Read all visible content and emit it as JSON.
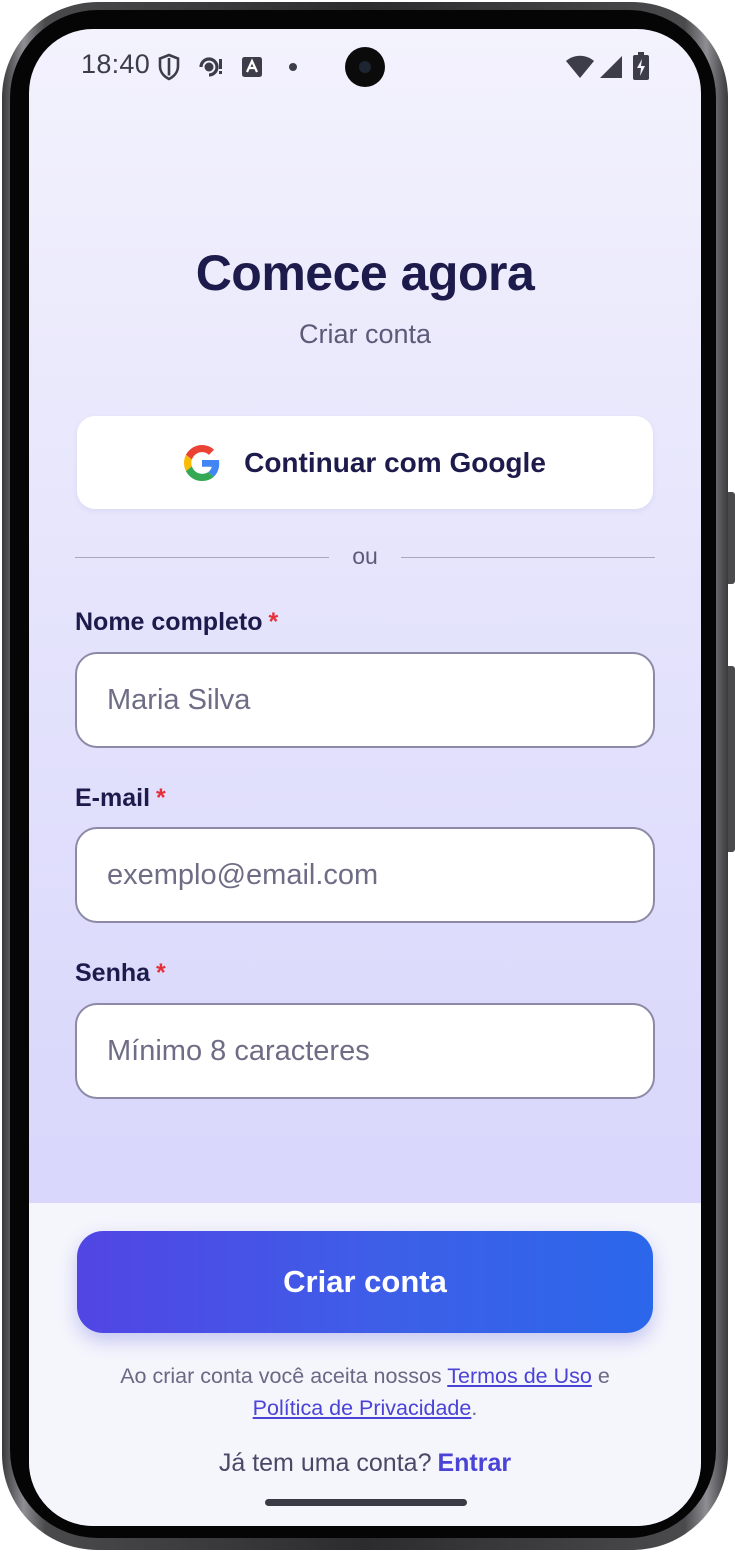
{
  "status_bar": {
    "time": "18:40",
    "left_icons": [
      "shield-icon",
      "sync-alert-icon",
      "text-a-icon",
      "dot-icon"
    ],
    "right_icons": [
      "wifi-icon",
      "cellular-icon",
      "battery-charging-icon"
    ]
  },
  "header": {
    "title": "Comece agora",
    "subtitle": "Criar conta"
  },
  "google_button": {
    "label": "Continuar com Google",
    "icon": "google-icon"
  },
  "divider": {
    "label": "ou"
  },
  "form": {
    "required_marker": "*",
    "fields": [
      {
        "label": "Nome completo",
        "placeholder": "Maria Silva",
        "value": ""
      },
      {
        "label": "E-mail",
        "placeholder": "exemplo@email.com",
        "value": ""
      },
      {
        "label": "Senha",
        "placeholder": "Mínimo 8 caracteres",
        "value": ""
      }
    ]
  },
  "footer": {
    "submit_label": "Criar conta",
    "terms_prefix": "Ao criar conta você aceita nossos",
    "terms_link": "Termos de Uso",
    "terms_conjunction": "e",
    "privacy_link": "Política de Privacidade",
    "terms_suffix": ".",
    "login_prompt": "Já tem uma conta?",
    "login_link": "Entrar"
  },
  "colors": {
    "title": "#1d1b4b",
    "accent": "#4b43d6",
    "button_gradient_start": "#5145e4",
    "button_gradient_end": "#2b67eb",
    "required": "#e5303a",
    "background_top": "#f3f2fd",
    "background_bottom": "#d6d4fa"
  }
}
